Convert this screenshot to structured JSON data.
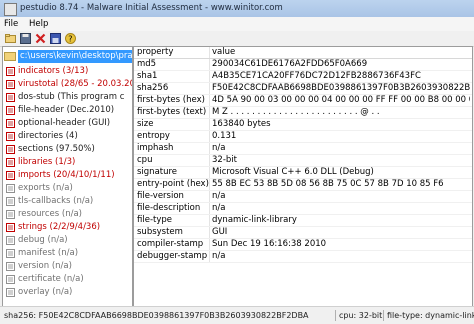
{
  "window": {
    "title": "pestudio 8.74 - Malware Initial Assessment - www.winitor.com"
  },
  "menu": {
    "file": "File",
    "help": "Help"
  },
  "toolbar": {
    "items": [
      "open-icon",
      "save-icon",
      "close-icon",
      "export-icon",
      "help-icon"
    ]
  },
  "tree": {
    "root": "c:\\users\\kevin\\desktop\\practi",
    "items": [
      {
        "label": "indicators (3/13)",
        "style": "red"
      },
      {
        "label": "virustotal (28/65 - 20.03.20",
        "style": "red"
      },
      {
        "label": "dos-stub (This program c",
        "style": "dark"
      },
      {
        "label": "file-header (Dec.2010)",
        "style": "dark"
      },
      {
        "label": "optional-header (GUI)",
        "style": "dark"
      },
      {
        "label": "directories (4)",
        "style": "dark"
      },
      {
        "label": "sections (97.50%)",
        "style": "dark"
      },
      {
        "label": "libraries (1/3)",
        "style": "red"
      },
      {
        "label": "imports (20/4/10/1/11)",
        "style": "red"
      },
      {
        "label": "exports (n/a)",
        "style": "grey"
      },
      {
        "label": "tls-callbacks (n/a)",
        "style": "grey"
      },
      {
        "label": "resources (n/a)",
        "style": "grey"
      },
      {
        "label": "strings (2/2/9/4/36)",
        "style": "red"
      },
      {
        "label": "debug (n/a)",
        "style": "grey"
      },
      {
        "label": "manifest (n/a)",
        "style": "grey"
      },
      {
        "label": "version (n/a)",
        "style": "grey"
      },
      {
        "label": "certificate (n/a)",
        "style": "grey"
      },
      {
        "label": "overlay (n/a)",
        "style": "grey"
      }
    ]
  },
  "grid": {
    "header": {
      "property": "property",
      "value": "value"
    },
    "rows": [
      {
        "property": "md5",
        "value": "290034C61DE6176A2FDD65F0A669"
      },
      {
        "property": "sha1",
        "value": "A4B35CE71CA20FF76DC72D12FB2886736F43FC"
      },
      {
        "property": "sha256",
        "value": "F50E42C8CDFAAB6698BDE0398861397F0B3B2603930822BF2DBA"
      },
      {
        "property": "first-bytes (hex)",
        "value": "4D 5A 90 00 03 00 00 00 04 00 00 00 FF FF 00 00 B8 00 00 00 00 00 00 00 40 00"
      },
      {
        "property": "first-bytes (text)",
        "value": "M Z . . . . . . . . . . . . . . . . . . . . . . . . @ . ."
      },
      {
        "property": "size",
        "value": "163840 bytes"
      },
      {
        "property": "entropy",
        "value": "0.131"
      },
      {
        "property": "imphash",
        "value": "n/a"
      },
      {
        "property": "cpu",
        "value": "32-bit"
      },
      {
        "property": "signature",
        "value": "Microsoft Visual C++ 6.0 DLL (Debug)"
      },
      {
        "property": "entry-point (hex)",
        "value": "55 8B EC 53 8B 5D 08 56 8B 75 0C 57 8B 7D 10 85 F6"
      },
      {
        "property": "file-version",
        "value": "n/a"
      },
      {
        "property": "file-description",
        "value": "n/a"
      },
      {
        "property": "file-type",
        "value": "dynamic-link-library"
      },
      {
        "property": "subsystem",
        "value": "GUI"
      },
      {
        "property": "compiler-stamp",
        "value": "Sun Dec 19 16:16:38 2010"
      },
      {
        "property": "debugger-stamp",
        "value": "n/a"
      }
    ]
  },
  "status": {
    "hash": "sha256: F50E42C8CDFAAB6698BDE0398861397F0B3B2603930822BF2DBA",
    "cpu": "cpu: 32-bit",
    "filetype": "file-type: dynamic-link-libr"
  }
}
